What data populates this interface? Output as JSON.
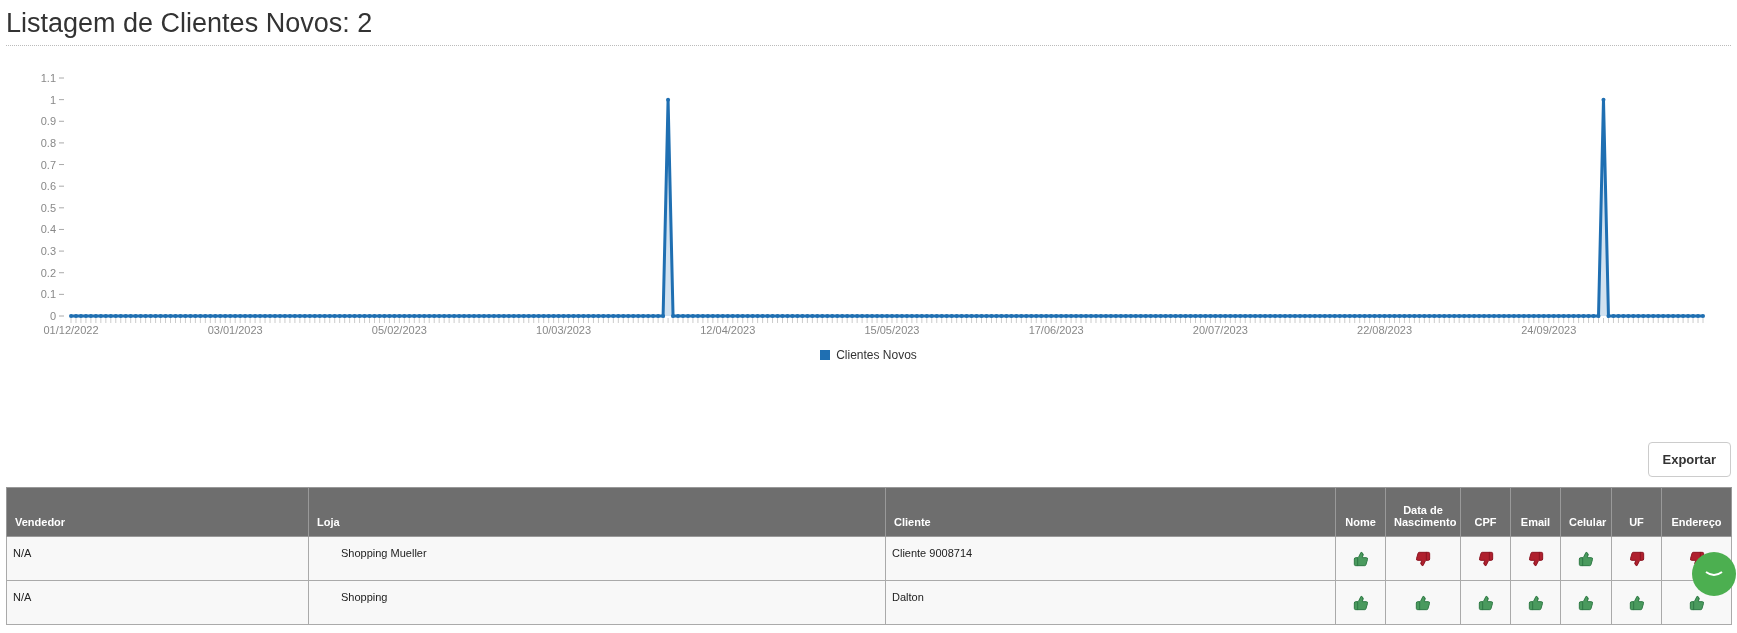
{
  "title": "Listagem de Clientes Novos: 2",
  "chart": {
    "chart_data": {
      "type": "area",
      "ylim": [
        0,
        1.1
      ],
      "yticks": [
        0,
        0.1,
        0.2,
        0.3,
        0.4,
        0.5,
        0.6,
        0.7,
        0.8,
        0.9,
        1,
        1.1
      ],
      "categories": [
        "01/12/2022",
        null,
        null,
        null,
        null,
        null,
        null,
        null,
        null,
        null,
        null,
        null,
        null,
        null,
        null,
        null,
        null,
        null,
        null,
        null,
        null,
        null,
        null,
        null,
        null,
        null,
        null,
        null,
        null,
        null,
        null,
        null,
        null,
        "03/01/2023",
        null,
        null,
        null,
        null,
        null,
        null,
        null,
        null,
        null,
        null,
        null,
        null,
        null,
        null,
        null,
        null,
        null,
        null,
        null,
        null,
        null,
        null,
        null,
        null,
        null,
        null,
        null,
        null,
        null,
        null,
        null,
        null,
        "05/02/2023",
        null,
        null,
        null,
        null,
        null,
        null,
        null,
        null,
        null,
        null,
        null,
        null,
        null,
        null,
        null,
        null,
        null,
        null,
        null,
        null,
        null,
        null,
        null,
        null,
        null,
        null,
        null,
        null,
        null,
        null,
        null,
        null,
        "10/03/2023",
        null,
        null,
        null,
        null,
        null,
        null,
        null,
        null,
        null,
        null,
        null,
        null,
        null,
        null,
        null,
        null,
        null,
        null,
        null,
        null,
        null,
        null,
        null,
        null,
        null,
        null,
        null,
        null,
        null,
        null,
        null,
        null,
        "12/04/2023",
        null,
        null,
        null,
        null,
        null,
        null,
        null,
        null,
        null,
        null,
        null,
        null,
        null,
        null,
        null,
        null,
        null,
        null,
        null,
        null,
        null,
        null,
        null,
        null,
        null,
        null,
        null,
        null,
        null,
        null,
        null,
        null,
        "15/05/2023",
        null,
        null,
        null,
        null,
        null,
        null,
        null,
        null,
        null,
        null,
        null,
        null,
        null,
        null,
        null,
        null,
        null,
        null,
        null,
        null,
        null,
        null,
        null,
        null,
        null,
        null,
        null,
        null,
        null,
        null,
        null,
        null,
        "17/06/2023",
        null,
        null,
        null,
        null,
        null,
        null,
        null,
        null,
        null,
        null,
        null,
        null,
        null,
        null,
        null,
        null,
        null,
        null,
        null,
        null,
        null,
        null,
        null,
        null,
        null,
        null,
        null,
        null,
        null,
        null,
        null,
        null,
        "20/07/2023",
        null,
        null,
        null,
        null,
        null,
        null,
        null,
        null,
        null,
        null,
        null,
        null,
        null,
        null,
        null,
        null,
        null,
        null,
        null,
        null,
        null,
        null,
        null,
        null,
        null,
        null,
        null,
        null,
        null,
        null,
        null,
        null,
        "22/08/2023",
        null,
        null,
        null,
        null,
        null,
        null,
        null,
        null,
        null,
        null,
        null,
        null,
        null,
        null,
        null,
        null,
        null,
        null,
        null,
        null,
        null,
        null,
        null,
        null,
        null,
        null,
        null,
        null,
        null,
        null,
        null,
        null,
        "24/09/2023",
        null,
        null,
        null,
        null,
        null,
        null,
        null,
        null,
        null,
        null,
        null,
        null,
        null,
        null,
        null,
        null,
        null,
        null,
        null,
        null,
        null,
        null,
        null,
        null,
        null,
        null,
        null,
        null,
        null,
        null,
        null
      ],
      "series": [
        {
          "name": "Clientes Novos",
          "color": "#1f6fb2",
          "values": [
            0,
            0,
            0,
            0,
            0,
            0,
            0,
            0,
            0,
            0,
            0,
            0,
            0,
            0,
            0,
            0,
            0,
            0,
            0,
            0,
            0,
            0,
            0,
            0,
            0,
            0,
            0,
            0,
            0,
            0,
            0,
            0,
            0,
            0,
            0,
            0,
            0,
            0,
            0,
            0,
            0,
            0,
            0,
            0,
            0,
            0,
            0,
            0,
            0,
            0,
            0,
            0,
            0,
            0,
            0,
            0,
            0,
            0,
            0,
            0,
            0,
            0,
            0,
            0,
            0,
            0,
            0,
            0,
            0,
            0,
            0,
            0,
            0,
            0,
            0,
            0,
            0,
            0,
            0,
            0,
            0,
            0,
            0,
            0,
            0,
            0,
            0,
            0,
            0,
            0,
            0,
            0,
            0,
            0,
            0,
            0,
            0,
            0,
            0,
            0,
            0,
            0,
            0,
            0,
            0,
            0,
            0,
            0,
            0,
            0,
            0,
            0,
            0,
            0,
            0,
            0,
            0,
            0,
            0,
            0,
            1,
            0,
            0,
            0,
            0,
            0,
            0,
            0,
            0,
            0,
            0,
            0,
            0,
            0,
            0,
            0,
            0,
            0,
            0,
            0,
            0,
            0,
            0,
            0,
            0,
            0,
            0,
            0,
            0,
            0,
            0,
            0,
            0,
            0,
            0,
            0,
            0,
            0,
            0,
            0,
            0,
            0,
            0,
            0,
            0,
            0,
            0,
            0,
            0,
            0,
            0,
            0,
            0,
            0,
            0,
            0,
            0,
            0,
            0,
            0,
            0,
            0,
            0,
            0,
            0,
            0,
            0,
            0,
            0,
            0,
            0,
            0,
            0,
            0,
            0,
            0,
            0,
            0,
            0,
            0,
            0,
            0,
            0,
            0,
            0,
            0,
            0,
            0,
            0,
            0,
            0,
            0,
            0,
            0,
            0,
            0,
            0,
            0,
            0,
            0,
            0,
            0,
            0,
            0,
            0,
            0,
            0,
            0,
            0,
            0,
            0,
            0,
            0,
            0,
            0,
            0,
            0,
            0,
            0,
            0,
            0,
            0,
            0,
            0,
            0,
            0,
            0,
            0,
            0,
            0,
            0,
            0,
            0,
            0,
            0,
            0,
            0,
            0,
            0,
            0,
            0,
            0,
            0,
            0,
            0,
            0,
            0,
            0,
            0,
            0,
            0,
            0,
            0,
            0,
            0,
            0,
            0,
            0,
            0,
            0,
            0,
            0,
            0,
            0,
            0,
            0,
            0,
            0,
            0,
            0,
            0,
            0,
            0,
            0,
            0,
            0,
            0,
            0,
            0,
            0,
            0,
            0,
            0,
            0,
            0,
            0,
            0,
            0,
            1,
            0,
            0,
            0,
            0,
            0,
            0,
            0,
            0,
            0,
            0,
            0,
            0,
            0,
            0,
            0,
            0,
            0,
            0,
            0,
            0
          ]
        }
      ]
    }
  },
  "export_button": "Exportar",
  "table": {
    "columns": [
      {
        "label": "Vendedor",
        "kind": "text"
      },
      {
        "label": "Loja",
        "kind": "text"
      },
      {
        "label": "Cliente",
        "kind": "text"
      },
      {
        "label": "Nome",
        "kind": "check"
      },
      {
        "label": "Data de Nascimento",
        "kind": "check"
      },
      {
        "label": "CPF",
        "kind": "check"
      },
      {
        "label": "Email",
        "kind": "check"
      },
      {
        "label": "Celular",
        "kind": "check"
      },
      {
        "label": "UF",
        "kind": "check"
      },
      {
        "label": "Endereço",
        "kind": "check"
      }
    ],
    "rows": [
      {
        "vendedor": "N/A",
        "loja": "Shopping Mueller",
        "cliente": "Cliente 9008714",
        "checks": [
          {
            "ok": true
          },
          {
            "ok": false
          },
          {
            "ok": false
          },
          {
            "ok": false
          },
          {
            "ok": true
          },
          {
            "ok": false
          },
          {
            "ok": false
          }
        ]
      },
      {
        "vendedor": "N/A",
        "loja": "Shopping",
        "cliente": "Dalton",
        "checks": [
          {
            "ok": true
          },
          {
            "ok": true
          },
          {
            "ok": true
          },
          {
            "ok": true
          },
          {
            "ok": true
          },
          {
            "ok": true
          },
          {
            "ok": true
          }
        ]
      }
    ]
  }
}
